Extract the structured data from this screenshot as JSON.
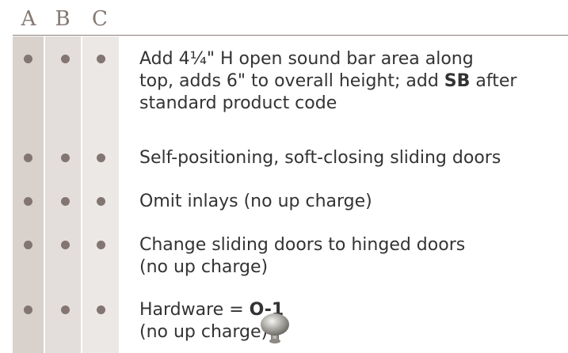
{
  "headers": [
    "A",
    "B",
    "C"
  ],
  "rows": [
    {
      "text_before": "Add 4¼\" H open sound bar area along\ntop, adds 6\" to overall height; add ",
      "bold": "SB",
      "text_after": " after\nstandard product code"
    },
    {
      "text_before": "Self-positioning, soft-closing sliding doors",
      "bold": "",
      "text_after": ""
    },
    {
      "text_before": "Omit inlays (no up charge)",
      "bold": "",
      "text_after": ""
    },
    {
      "text_before": "Change sliding doors to hinged doors\n(no up charge)",
      "bold": "",
      "text_after": ""
    },
    {
      "text_before": "Hardware = ",
      "bold": "O-1",
      "text_after": "\n(no up charge)"
    }
  ],
  "colors": {
    "col_a": "#d8d1cc",
    "col_b": "#e3dedb",
    "col_c": "#ece8e5",
    "dot": "#837571",
    "header_text": "#857873"
  },
  "icons": {
    "hardware": "round-knob-icon"
  }
}
